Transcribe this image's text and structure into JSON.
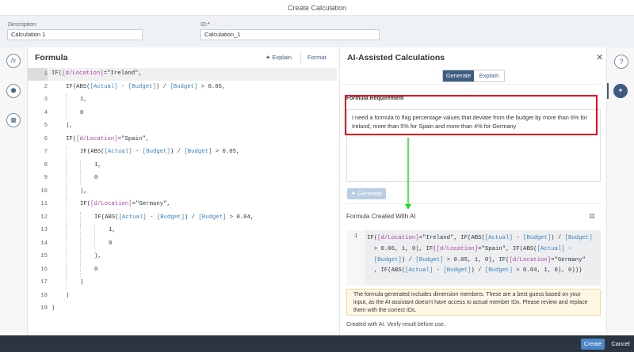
{
  "dialog": {
    "title": "Create Calculation"
  },
  "fields": {
    "description_label": "Description:",
    "description_value": "Calculation 1",
    "id_label": "ID:",
    "id_required": "*",
    "id_value": "Calculation_1"
  },
  "formula": {
    "title": "Formula",
    "explain": "Explain",
    "format": "Format",
    "lines": [
      [
        [
          0,
          ""
        ],
        [
          "IF(",
          ""
        ],
        [
          "[d/Location]",
          "dim"
        ],
        [
          "=\"Ireland\",",
          ""
        ]
      ],
      [
        [
          1,
          ""
        ],
        [
          "IF(ABS(",
          ""
        ],
        [
          "[Actual]",
          "meas"
        ],
        [
          " - ",
          ""
        ],
        [
          "[Budget]",
          "meas"
        ],
        [
          ") / ",
          ""
        ],
        [
          "[Budget]",
          "meas"
        ],
        [
          " > 0.06,",
          ""
        ]
      ],
      [
        [
          2,
          ""
        ],
        [
          "1,",
          ""
        ]
      ],
      [
        [
          2,
          ""
        ],
        [
          "0",
          ""
        ]
      ],
      [
        [
          1,
          ""
        ],
        [
          "),",
          ""
        ]
      ],
      [
        [
          1,
          ""
        ],
        [
          "IF(",
          ""
        ],
        [
          "[d/Location]",
          "dim"
        ],
        [
          "=\"Spain\",",
          ""
        ]
      ],
      [
        [
          2,
          ""
        ],
        [
          "IF(ABS(",
          ""
        ],
        [
          "[Actual]",
          "meas"
        ],
        [
          " - ",
          ""
        ],
        [
          "[Budget]",
          "meas"
        ],
        [
          ") / ",
          ""
        ],
        [
          "[Budget]",
          "meas"
        ],
        [
          " > 0.05,",
          ""
        ]
      ],
      [
        [
          3,
          ""
        ],
        [
          "1,",
          ""
        ]
      ],
      [
        [
          3,
          ""
        ],
        [
          "0",
          ""
        ]
      ],
      [
        [
          2,
          ""
        ],
        [
          "),",
          ""
        ]
      ],
      [
        [
          2,
          ""
        ],
        [
          "IF(",
          ""
        ],
        [
          "[d/Location]",
          "dim"
        ],
        [
          "=\"Germany\",",
          ""
        ]
      ],
      [
        [
          3,
          ""
        ],
        [
          "IF(ABS(",
          ""
        ],
        [
          "[Actual]",
          "meas"
        ],
        [
          " - ",
          ""
        ],
        [
          "[Budget]",
          "meas"
        ],
        [
          ") / ",
          ""
        ],
        [
          "[Budget]",
          "meas"
        ],
        [
          " > 0.04,",
          ""
        ]
      ],
      [
        [
          4,
          ""
        ],
        [
          "1,",
          ""
        ]
      ],
      [
        [
          4,
          ""
        ],
        [
          "0",
          ""
        ]
      ],
      [
        [
          3,
          ""
        ],
        [
          "),",
          ""
        ]
      ],
      [
        [
          3,
          ""
        ],
        [
          "0",
          ""
        ]
      ],
      [
        [
          2,
          ""
        ],
        [
          ")",
          ""
        ]
      ],
      [
        [
          1,
          ""
        ],
        [
          ")",
          ""
        ]
      ],
      [
        [
          0,
          ""
        ],
        [
          ")",
          ""
        ]
      ]
    ]
  },
  "ai": {
    "title": "AI-Assisted Calculations",
    "tabs": [
      "Generate",
      "Explain"
    ],
    "requirement_label": "Formula Requirement",
    "requirement_text": "I need a formula to flag percentage values that deviate from the budget by more than 6% for Ireland, more than 5% for Spain and more than 4% for Germany",
    "generate_button": "Generate",
    "result_title": "Formula Created With AI",
    "result_line_number": "1",
    "result_lines": [
      [
        [
          "IF(",
          ""
        ],
        [
          "[d/Location]",
          "dim"
        ],
        [
          "=\"Ireland\", IF(ABS(",
          ""
        ],
        [
          "[Actual]",
          "meas"
        ],
        [
          " - ",
          ""
        ],
        [
          "[Budget]",
          "meas"
        ],
        [
          ") / ",
          ""
        ],
        [
          "[Budget]",
          "meas"
        ]
      ],
      [
        [
          "  > 0.06, 1, 0), IF(",
          ""
        ],
        [
          "[d/Location]",
          "dim"
        ],
        [
          "=\"Spain\", IF(ABS(",
          ""
        ],
        [
          "[Actual]",
          "meas"
        ],
        [
          " -",
          ""
        ]
      ],
      [
        [
          "  ",
          ""
        ],
        [
          "[Budget]",
          "meas"
        ],
        [
          ") / ",
          ""
        ],
        [
          "[Budget]",
          "meas"
        ],
        [
          " > 0.05, 1, 0), IF(",
          ""
        ],
        [
          "[d/Location]",
          "dim"
        ],
        [
          "=\"Germany\"",
          ""
        ]
      ],
      [
        [
          "  , IF(ABS(",
          ""
        ],
        [
          "[Actual]",
          "meas"
        ],
        [
          " - ",
          ""
        ],
        [
          "[Budget]",
          "meas"
        ],
        [
          ") / ",
          ""
        ],
        [
          "[Budget]",
          "meas"
        ],
        [
          " > 0.04, 1, 0), 0)))",
          ""
        ]
      ]
    ],
    "warning": "The formula generated includes dimension members. These are a best guess based on your input, as the AI assistant doesn't have access to actual member IDs. Please review and replace them with the correct IDs.",
    "disclaimer": "Created with AI. Verify result before use."
  },
  "footer": {
    "create": "Create",
    "cancel": "Cancel"
  },
  "colors": {
    "accent": "#3e5b80",
    "highlight": "#e8001c",
    "arrow": "#22dd22",
    "footer": "#2c3440"
  }
}
